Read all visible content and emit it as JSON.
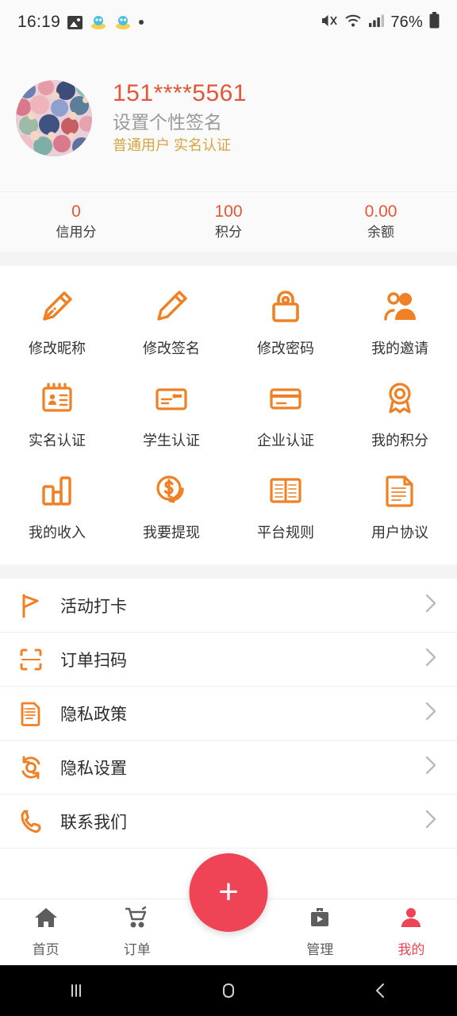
{
  "statusbar": {
    "time": "16:19",
    "battery": "76%",
    "icons": [
      "image-icon",
      "app-icon",
      "app-icon",
      "dot-icon"
    ],
    "right_icons": [
      "mute-icon",
      "wifi-icon",
      "signal-icon",
      "battery-icon"
    ]
  },
  "profile": {
    "avatar_name": "user-avatar",
    "phone": "151****5561",
    "signature_placeholder": "设置个性签名",
    "tags": "普通用户 实名认证"
  },
  "stats": [
    {
      "value": "0",
      "label": "信用分"
    },
    {
      "value": "100",
      "label": "积分"
    },
    {
      "value": "0.00",
      "label": "余额"
    }
  ],
  "grid": [
    {
      "label": "修改昵称",
      "icon": "pen-nib-icon"
    },
    {
      "label": "修改签名",
      "icon": "pencil-icon"
    },
    {
      "label": "修改密码",
      "icon": "lock-icon"
    },
    {
      "label": "我的邀请",
      "icon": "users-group-icon"
    },
    {
      "label": "实名认证",
      "icon": "id-card-icon"
    },
    {
      "label": "学生认证",
      "icon": "student-card-icon"
    },
    {
      "label": "企业认证",
      "icon": "credit-card-icon"
    },
    {
      "label": "我的积分",
      "icon": "medal-icon"
    },
    {
      "label": "我的收入",
      "icon": "bar-chart-icon"
    },
    {
      "label": "我要提现",
      "icon": "coin-dollar-icon"
    },
    {
      "label": "平台规则",
      "icon": "open-book-icon"
    },
    {
      "label": "用户协议",
      "icon": "document-icon"
    }
  ],
  "list": [
    {
      "label": "活动打卡",
      "icon": "flag-icon"
    },
    {
      "label": "订单扫码",
      "icon": "scan-frame-icon"
    },
    {
      "label": "隐私政策",
      "icon": "policy-document-icon"
    },
    {
      "label": "隐私设置",
      "icon": "sync-settings-icon"
    },
    {
      "label": "联系我们",
      "icon": "phone-icon"
    }
  ],
  "tabbar": [
    {
      "label": "首页",
      "icon": "home-icon",
      "active": false
    },
    {
      "label": "订单",
      "icon": "cart-icon",
      "active": false
    },
    {
      "label": "管理",
      "icon": "briefcase-play-icon",
      "active": false
    },
    {
      "label": "我的",
      "icon": "person-icon",
      "active": true
    }
  ],
  "fab": {
    "label": "+",
    "name": "add-button"
  },
  "navbar": [
    "recents-button",
    "home-button",
    "back-button"
  ],
  "colors": {
    "accent_orange": "#f08026",
    "text_orange": "#e2563a",
    "gold": "#d6a441",
    "fab_red": "#ee4455",
    "bg_gray": "#f4f4f4",
    "panel": "#ffffff"
  }
}
